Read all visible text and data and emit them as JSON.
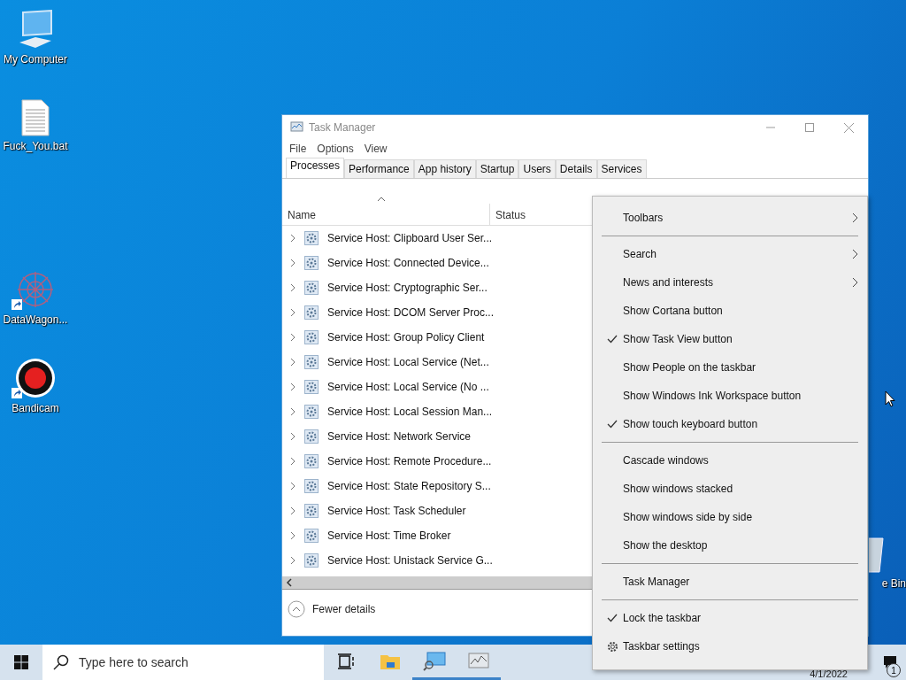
{
  "desktop": {
    "icons": [
      {
        "label": "My Computer",
        "kind": "computer",
        "shortcut": false
      },
      {
        "label": "Fuck_You.bat",
        "kind": "file",
        "shortcut": false
      },
      {
        "label": "DataWagon...",
        "kind": "star",
        "shortcut": true
      },
      {
        "label": "Bandicam",
        "kind": "record",
        "shortcut": true
      },
      {
        "label": "e Bin",
        "kind": "bin",
        "shortcut": false
      }
    ]
  },
  "task_manager": {
    "title": "Task Manager",
    "menu": [
      "File",
      "Options",
      "View"
    ],
    "tabs": [
      {
        "label": "Processes",
        "selected": true
      },
      {
        "label": "Performance",
        "selected": false
      },
      {
        "label": "App history",
        "selected": false
      },
      {
        "label": "Startup",
        "selected": false
      },
      {
        "label": "Users",
        "selected": false
      },
      {
        "label": "Details",
        "selected": false
      },
      {
        "label": "Services",
        "selected": false
      }
    ],
    "columns": [
      "Name",
      "Status"
    ],
    "rows": [
      "Service Host: Clipboard User Ser...",
      "Service Host: Connected Device...",
      "Service Host: Cryptographic Ser...",
      "Service Host: DCOM Server Proc...",
      "Service Host: Group Policy Client",
      "Service Host: Local Service (Net...",
      "Service Host: Local Service (No ...",
      "Service Host: Local Session Man...",
      "Service Host: Network Service",
      "Service Host: Remote Procedure...",
      "Service Host: State Repository S...",
      "Service Host: Task Scheduler",
      "Service Host: Time Broker",
      "Service Host: Unistack Service G..."
    ],
    "footer": "Fewer details"
  },
  "context_menu": {
    "groups": [
      [
        {
          "label": "Toolbars",
          "kind": "submenu",
          "checked": false
        }
      ],
      [
        {
          "label": "Search",
          "kind": "submenu",
          "checked": false
        },
        {
          "label": "News and interests",
          "kind": "submenu",
          "checked": false
        },
        {
          "label": "Show Cortana button",
          "kind": "command",
          "checked": false
        },
        {
          "label": "Show Task View button",
          "kind": "command",
          "checked": true
        },
        {
          "label": "Show People on the taskbar",
          "kind": "command",
          "checked": false
        },
        {
          "label": "Show Windows Ink Workspace button",
          "kind": "command",
          "checked": false
        },
        {
          "label": "Show touch keyboard button",
          "kind": "command",
          "checked": true
        }
      ],
      [
        {
          "label": "Cascade windows",
          "kind": "command",
          "checked": false
        },
        {
          "label": "Show windows stacked",
          "kind": "command",
          "checked": false
        },
        {
          "label": "Show windows side by side",
          "kind": "command",
          "checked": false
        },
        {
          "label": "Show the desktop",
          "kind": "command",
          "checked": false
        }
      ],
      [
        {
          "label": "Task Manager",
          "kind": "command",
          "checked": false
        }
      ],
      [
        {
          "label": "Lock the taskbar",
          "kind": "command",
          "checked": true
        },
        {
          "label": "Taskbar settings",
          "kind": "settings",
          "checked": false
        }
      ]
    ]
  },
  "taskbar": {
    "search": {
      "placeholder": "Type here to search"
    },
    "apps": [
      {
        "kind": "task-view",
        "running": false
      },
      {
        "kind": "explorer",
        "running": false
      },
      {
        "kind": "monitor",
        "running": true
      },
      {
        "kind": "chart",
        "running": true
      }
    ],
    "clock": "4/1/2022",
    "notification_count": "1"
  }
}
